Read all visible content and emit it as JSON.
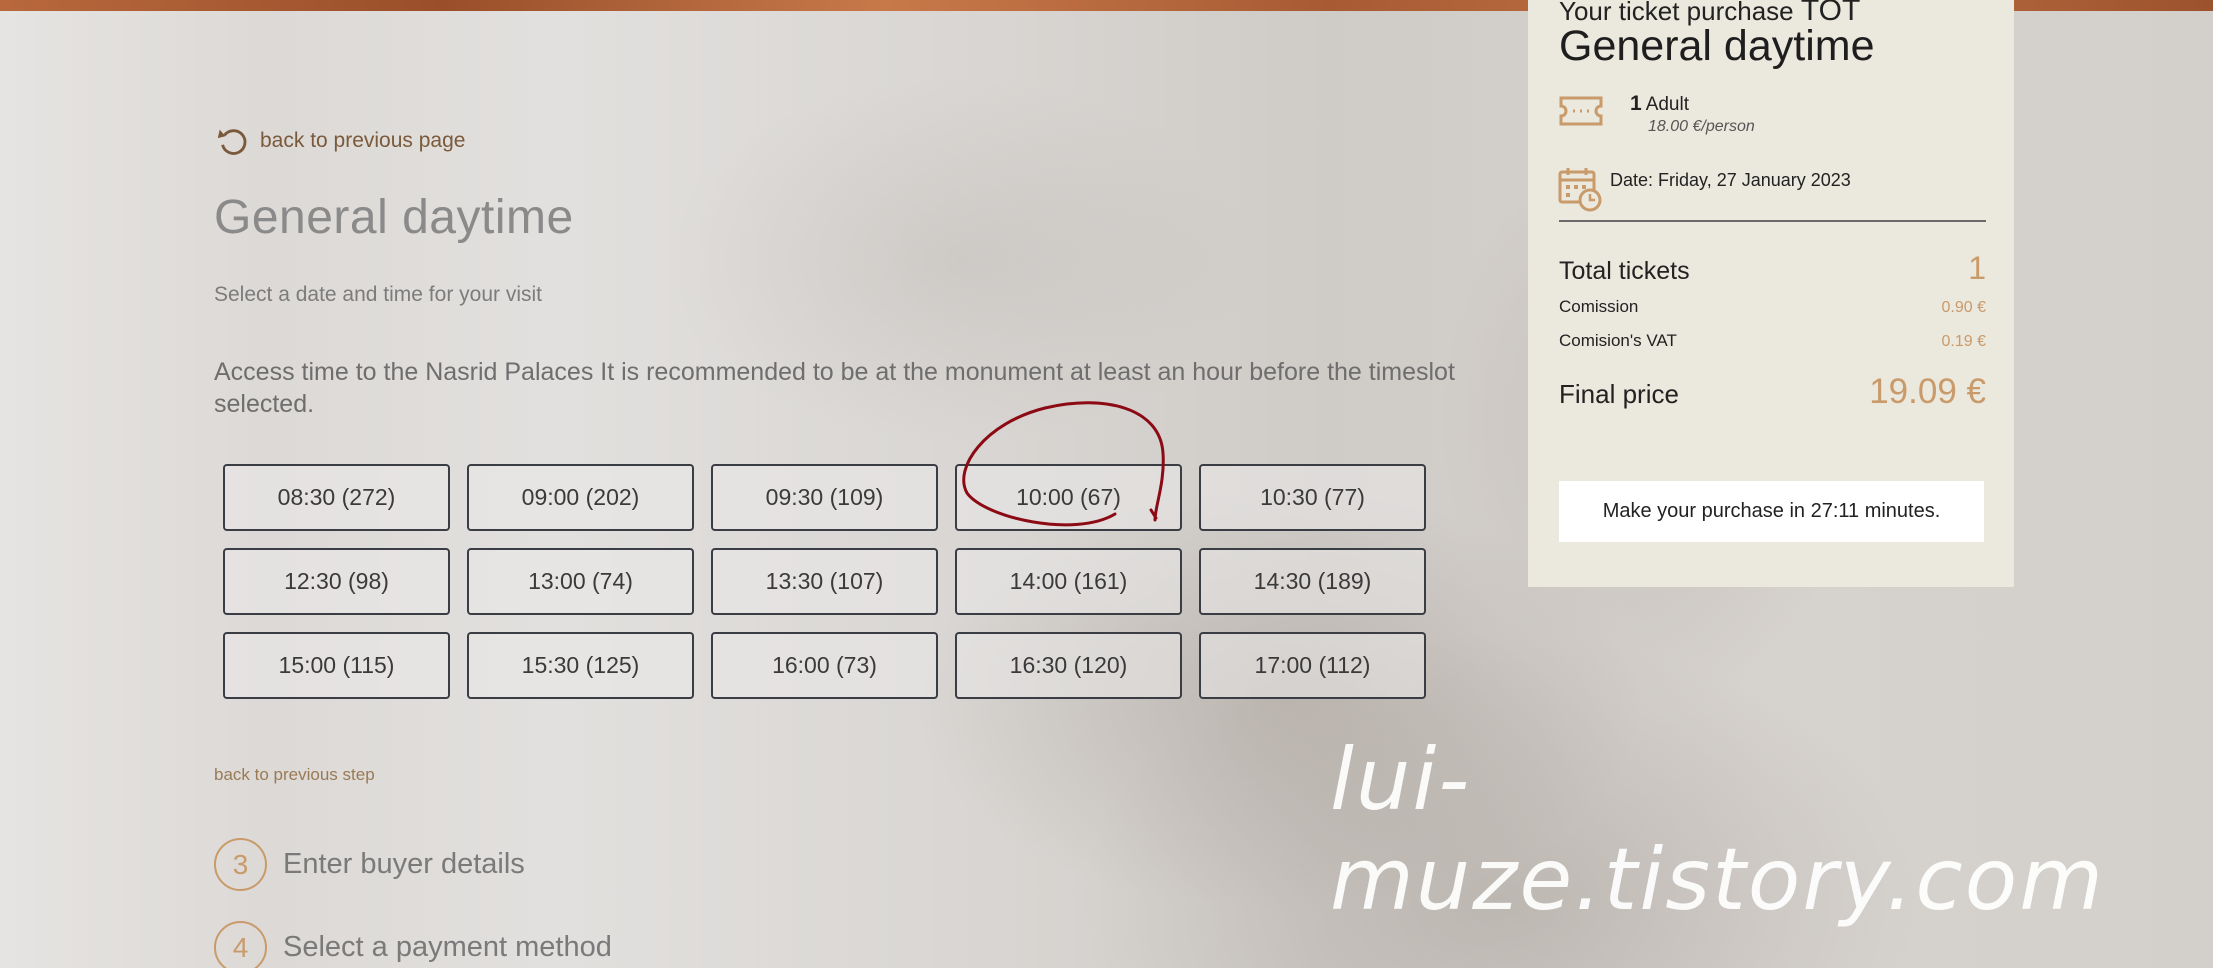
{
  "nav": {
    "back_page": "back to previous page",
    "back_step": "back to previous step"
  },
  "main": {
    "title": "General daytime",
    "subtitle": "Select a date and time for your visit",
    "access_text": "Access time to the Nasrid Palaces It is recommended to be at the monument at least an hour before the timeslot selected.",
    "slots": [
      "08:30 (272)",
      "09:00 (202)",
      "09:30 (109)",
      "10:00 (67)",
      "10:30 (77)",
      "12:30 (98)",
      "13:00 (74)",
      "13:30 (107)",
      "14:00 (161)",
      "14:30 (189)",
      "15:00 (115)",
      "15:30 (125)",
      "16:00 (73)",
      "16:30 (120)",
      "17:00 (112)"
    ]
  },
  "steps": [
    {
      "num": "3",
      "label": "Enter buyer details"
    },
    {
      "num": "4",
      "label": "Select a payment method"
    }
  ],
  "watermark": "lui-muze.tistory.com",
  "summary": {
    "head": "Your ticket purchase",
    "head_suffix": "TOT",
    "title": "General daytime",
    "qty": "1",
    "ticket_type": "Adult",
    "price_per_person": "18.00 €/person",
    "date": "Date: Friday, 27 January 2023",
    "total_tickets_label": "Total tickets",
    "total_tickets": "1",
    "commission_label": "Comission",
    "commission": "0.90 €",
    "vat_label": "Comision's VAT",
    "vat": "0.19 €",
    "final_label": "Final price",
    "final": "19.09 €",
    "timer": "Make your purchase in 27:11 minutes."
  },
  "colors": {
    "accent": "#c99a6a",
    "annotation": "#8b0a14",
    "panel": "#ebe8dd"
  },
  "icons": {
    "back": "undo-arrow-icon",
    "ticket": "ticket-icon",
    "calendar": "calendar-clock-icon"
  }
}
